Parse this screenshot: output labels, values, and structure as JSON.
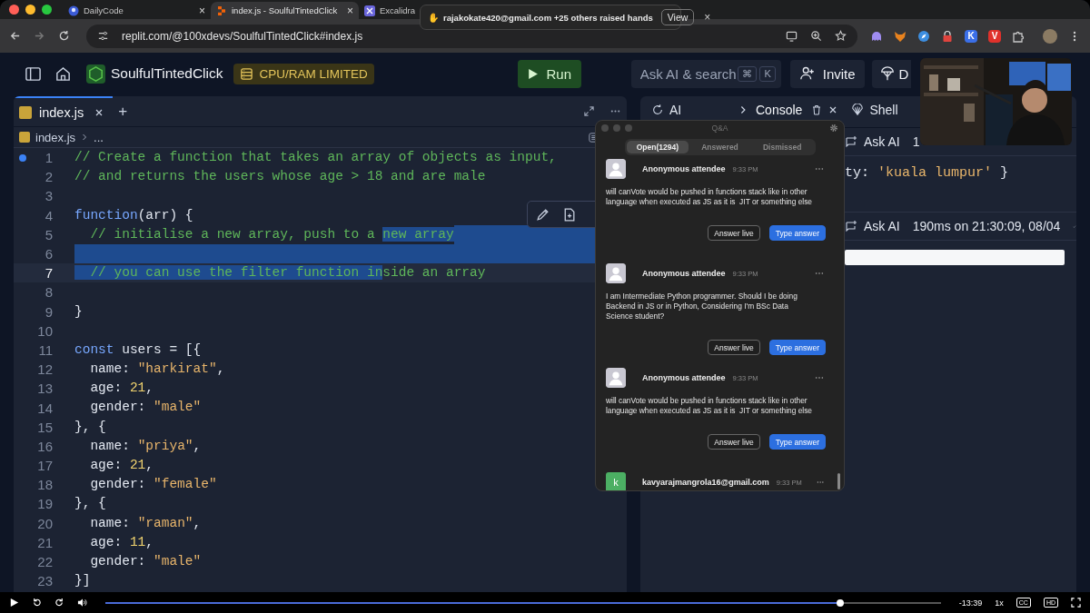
{
  "browser": {
    "tabs": [
      {
        "title": "DailyCode",
        "kind": "daily",
        "close": "×",
        "selected": false
      },
      {
        "title": "index.js - SoulfulTintedClick",
        "kind": "replit",
        "close": "×",
        "selected": true
      },
      {
        "title": "Excalidra",
        "kind": "excalidraw",
        "selected": false
      }
    ],
    "url": "replit.com/@100xdevs/SoulfulTintedClick#index.js",
    "extensions": [
      {
        "kind": "ghost",
        "color": "#9f8cf0"
      },
      {
        "kind": "fox",
        "color": "#e8821e"
      },
      {
        "kind": "compass",
        "color": "#3d8ee0"
      },
      {
        "kind": "lock",
        "color": "#e0443e"
      },
      {
        "kind": "letter",
        "label": "K",
        "color": "#3b6fe8"
      },
      {
        "kind": "letter",
        "label": "V",
        "color": "#e0312b"
      },
      {
        "kind": "puzzle"
      }
    ]
  },
  "notification": {
    "icon": "✋",
    "text": "rajakokate420@gmail.com +25 others raised hands",
    "button": "View",
    "close": "×"
  },
  "header": {
    "project": "SoulfulTintedClick",
    "badge": "CPU/RAM LIMITED",
    "run": "Run",
    "search": {
      "placeholder": "Ask AI & search",
      "keys": [
        "⌘",
        "K"
      ]
    },
    "invite": "Invite",
    "deploy": "D"
  },
  "editor": {
    "tab": "index.js",
    "add": "+",
    "breadcrumb": [
      "index.js",
      "..."
    ],
    "lines": [
      {
        "n": "1",
        "dot": true,
        "current": false,
        "fill_selected": false,
        "tokens": [
          {
            "t": "// Create a function that takes an array of objects as input,",
            "kind": "comment",
            "selected": false
          }
        ]
      },
      {
        "n": "2",
        "dot": false,
        "current": false,
        "fill_selected": false,
        "tokens": [
          {
            "t": "// and returns the users whose age > 18 and are male",
            "kind": "comment",
            "selected": false
          }
        ]
      },
      {
        "n": "3",
        "dot": false,
        "current": false,
        "fill_selected": false
      },
      {
        "n": "4",
        "dot": false,
        "current": false,
        "fill_selected": false,
        "tokens": [
          {
            "t": "function",
            "kind": "keyword",
            "selected": false
          },
          {
            "t": "(arr) {",
            "kind": "plain",
            "selected": false
          }
        ]
      },
      {
        "n": "5",
        "dot": false,
        "current": false,
        "fill_selected": true,
        "tokens": [
          {
            "t": "  // initialise a new array, push to a ",
            "kind": "comment",
            "selected": false
          },
          {
            "t": "new array",
            "kind": "comment",
            "selected": true
          }
        ]
      },
      {
        "n": "6",
        "dot": false,
        "current": false,
        "fill_selected": true
      },
      {
        "n": "7",
        "dot": false,
        "current": true,
        "fill_selected": false,
        "tokens": [
          {
            "t": "  // you can use the filter function in",
            "kind": "comment",
            "selected": true
          },
          {
            "t": "side an array",
            "kind": "comment",
            "selected": false
          }
        ]
      },
      {
        "n": "8",
        "dot": false,
        "current": false,
        "fill_selected": false
      },
      {
        "n": "9",
        "dot": false,
        "current": false,
        "fill_selected": false,
        "tokens": [
          {
            "t": "}",
            "kind": "plain",
            "selected": false
          }
        ]
      },
      {
        "n": "10",
        "dot": false,
        "current": false,
        "fill_selected": false
      },
      {
        "n": "11",
        "dot": false,
        "current": false,
        "fill_selected": false,
        "tokens": [
          {
            "t": "const",
            "kind": "keyword",
            "selected": false
          },
          {
            "t": " users = [{",
            "kind": "plain",
            "selected": false
          }
        ]
      },
      {
        "n": "12",
        "dot": false,
        "current": false,
        "fill_selected": false,
        "tokens": [
          {
            "t": "  name: ",
            "kind": "plain",
            "selected": false
          },
          {
            "t": "\"harkirat\"",
            "kind": "string",
            "selected": false
          },
          {
            "t": ",",
            "kind": "plain",
            "selected": false
          }
        ]
      },
      {
        "n": "13",
        "dot": false,
        "current": false,
        "fill_selected": false,
        "tokens": [
          {
            "t": "  age: ",
            "kind": "plain",
            "selected": false
          },
          {
            "t": "21",
            "kind": "number",
            "selected": false
          },
          {
            "t": ",",
            "kind": "plain",
            "selected": false
          }
        ]
      },
      {
        "n": "14",
        "dot": false,
        "current": false,
        "fill_selected": false,
        "tokens": [
          {
            "t": "  gender: ",
            "kind": "plain",
            "selected": false
          },
          {
            "t": "\"male\"",
            "kind": "string",
            "selected": false
          }
        ]
      },
      {
        "n": "15",
        "dot": false,
        "current": false,
        "fill_selected": false,
        "tokens": [
          {
            "t": "}, {",
            "kind": "plain",
            "selected": false
          }
        ]
      },
      {
        "n": "16",
        "dot": false,
        "current": false,
        "fill_selected": false,
        "tokens": [
          {
            "t": "  name: ",
            "kind": "plain",
            "selected": false
          },
          {
            "t": "\"priya\"",
            "kind": "string",
            "selected": false
          },
          {
            "t": ",",
            "kind": "plain",
            "selected": false
          }
        ]
      },
      {
        "n": "17",
        "dot": false,
        "current": false,
        "fill_selected": false,
        "tokens": [
          {
            "t": "  age: ",
            "kind": "plain",
            "selected": false
          },
          {
            "t": "21",
            "kind": "number",
            "selected": false
          },
          {
            "t": ",",
            "kind": "plain",
            "selected": false
          }
        ]
      },
      {
        "n": "18",
        "dot": false,
        "current": false,
        "fill_selected": false,
        "tokens": [
          {
            "t": "  gender: ",
            "kind": "plain",
            "selected": false
          },
          {
            "t": "\"female\"",
            "kind": "string",
            "selected": false
          }
        ]
      },
      {
        "n": "19",
        "dot": false,
        "current": false,
        "fill_selected": false,
        "tokens": [
          {
            "t": "}, {",
            "kind": "plain",
            "selected": false
          }
        ]
      },
      {
        "n": "20",
        "dot": false,
        "current": false,
        "fill_selected": false,
        "tokens": [
          {
            "t": "  name: ",
            "kind": "plain",
            "selected": false
          },
          {
            "t": "\"raman\"",
            "kind": "string",
            "selected": false
          },
          {
            "t": ",",
            "kind": "plain",
            "selected": false
          }
        ]
      },
      {
        "n": "21",
        "dot": false,
        "current": false,
        "fill_selected": false,
        "tokens": [
          {
            "t": "  age: ",
            "kind": "plain",
            "selected": false
          },
          {
            "t": "11",
            "kind": "number",
            "selected": false
          },
          {
            "t": ",",
            "kind": "plain",
            "selected": false
          }
        ]
      },
      {
        "n": "22",
        "dot": false,
        "current": false,
        "fill_selected": false,
        "tokens": [
          {
            "t": "  gender: ",
            "kind": "plain",
            "selected": false
          },
          {
            "t": "\"male\"",
            "kind": "string",
            "selected": false
          }
        ]
      },
      {
        "n": "23",
        "dot": false,
        "current": false,
        "fill_selected": false,
        "tokens": [
          {
            "t": "}]",
            "kind": "plain",
            "selected": false
          }
        ]
      }
    ]
  },
  "console": {
    "tabs": [
      {
        "label": "AI",
        "kind": "ai",
        "selected": false
      },
      {
        "label": "Console",
        "kind": "console",
        "selected": true
      },
      {
        "label": "Shell",
        "kind": "shell",
        "selected": false
      }
    ],
    "entries": [
      {
        "ask": "Ask AI",
        "info": "1",
        "ok": false,
        "output": [
          {
            "t": "ty: ",
            "kind": "plain"
          },
          {
            "t": "'kuala lumpur'",
            "kind": "string"
          },
          {
            "t": " }",
            "kind": "plain"
          }
        ]
      },
      {
        "ask": "Ask AI",
        "info": "190ms on 21:30:09, 08/04",
        "ok": true
      }
    ]
  },
  "qa": {
    "title": "Q&A",
    "tabs": [
      {
        "label": "Open(1294)",
        "selected": true
      },
      {
        "label": "Answered",
        "selected": false
      },
      {
        "label": "Dismissed",
        "selected": false
      }
    ],
    "questions": [
      {
        "kind": "anonymous",
        "author": "Anonymous attendee",
        "time": "9:33 PM",
        "text": "will canVote would be pushed in functions stack like in other language when executed as JS as it is  JIT or something else",
        "buttons": [
          "Answer live",
          "Type answer"
        ]
      },
      {
        "kind": "anonymous",
        "author": "Anonymous attendee",
        "time": "9:33 PM",
        "text": "I am Intermediate Python programmer. Should I be doing Backend in JS or in Python, Considering I'm BSc Data Science student?",
        "buttons": [
          "Answer live",
          "Type answer"
        ]
      },
      {
        "kind": "anonymous",
        "author": "Anonymous attendee",
        "time": "9:33 PM",
        "text": "will canVote would be pushed in functions stack like in other language when executed as JS as it is  JIT or something else",
        "buttons": [
          "Answer live",
          "Type answer"
        ]
      },
      {
        "kind": "letter",
        "letter": "k",
        "color": "#4caf63",
        "author": "kavyarajmangrola16@gmail.com",
        "time": "9:33 PM"
      }
    ]
  },
  "player": {
    "level": 0.88,
    "time": "-13:39",
    "speed": "1x",
    "captions": "CC",
    "quality": "HD"
  }
}
